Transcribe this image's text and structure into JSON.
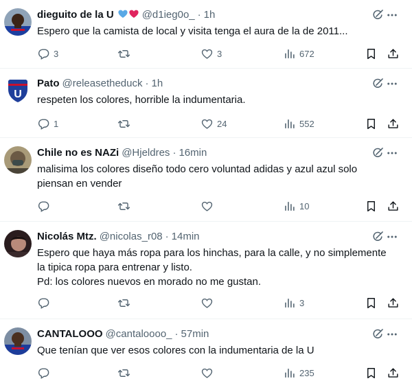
{
  "replies": [
    {
      "name": "dieguito de la U",
      "handle": "@d1ieg0o_",
      "time": "1h",
      "text": "Espero que la camista de local y visita tenga el aura de la de 2011...",
      "replies": "3",
      "retweets": "",
      "likes": "3",
      "views": "672",
      "badge_icons": [
        "blue-heart-icon",
        "red-heart-icon"
      ],
      "avatar": "blue-jersey-player"
    },
    {
      "name": "Pato",
      "handle": "@releasetheduck",
      "time": "1h",
      "text": "respeten los colores, horrible la indumentaria.",
      "replies": "1",
      "retweets": "",
      "likes": "24",
      "views": "552",
      "avatar": "u-crest"
    },
    {
      "name": "Chile no es NAZi",
      "handle": "@Hjeldres",
      "time": "16min",
      "text": "malisima los colores diseño todo cero voluntad adidas y azul azul solo piensan en vender",
      "replies": "",
      "retweets": "",
      "likes": "",
      "views": "10",
      "avatar": "masked-person"
    },
    {
      "name": "Nicolás Mtz.",
      "handle": "@nicolas_r08",
      "time": "14min",
      "text_lines": [
        "Espero que haya más ropa para los hinchas, para la calle, y no simplemente",
        "la tipica ropa para entrenar y listo.",
        "Pd: los colores nuevos en morado no me gustan."
      ],
      "replies": "",
      "retweets": "",
      "likes": "",
      "views": "3",
      "avatar": "dark-portrait"
    },
    {
      "name": "CANTALOOO",
      "handle": "@cantaloooo_",
      "time": "57min",
      "text": "Que tenían que ver esos colores con la indumentaria de la U",
      "replies": "",
      "retweets": "",
      "likes": "",
      "views": "235",
      "avatar": "blue-jersey-player"
    }
  ],
  "separator": "·",
  "icons": {
    "reply": "speech-bubble-icon",
    "retweet": "retweet-icon",
    "like": "heart-icon",
    "views": "bar-chart-icon",
    "bookmark": "bookmark-icon",
    "share": "share-icon",
    "grok": "grok-icon",
    "more": "more-dots-icon"
  },
  "colors": {
    "text": "#0f1419",
    "secondary": "#536471",
    "divider": "#eff3f4",
    "blue_heart": "#5aa9e6",
    "red_heart": "#e0245e"
  }
}
